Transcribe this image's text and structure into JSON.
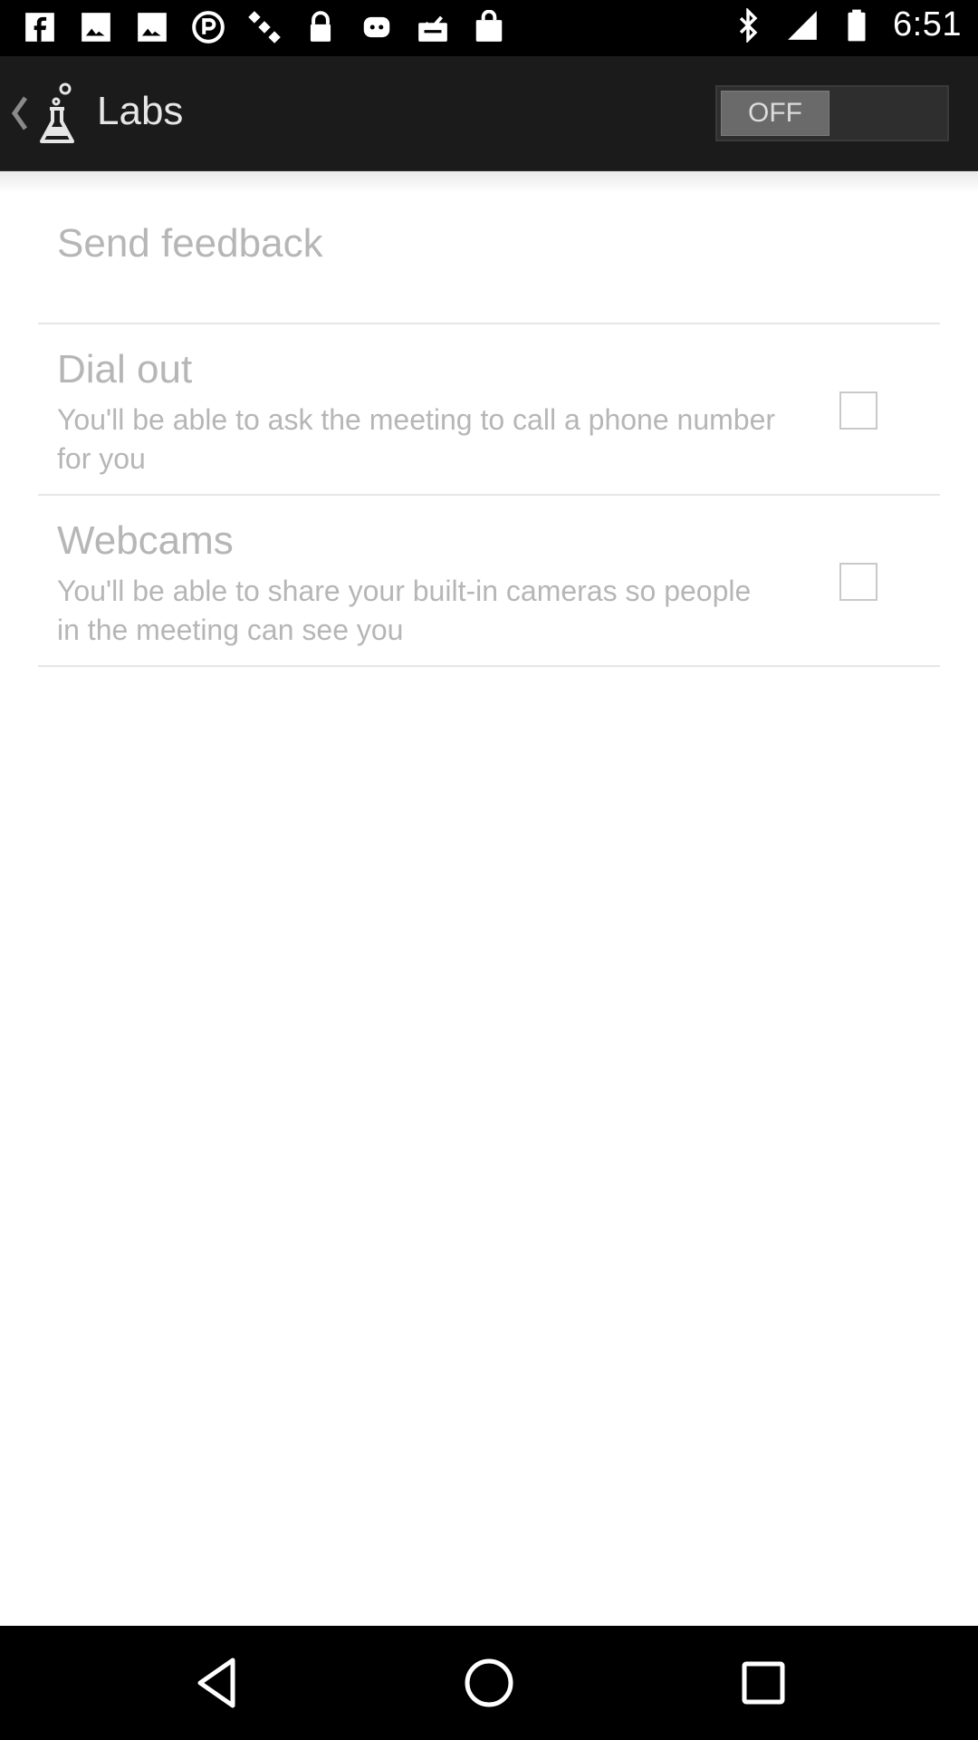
{
  "status_bar": {
    "time": "6:51",
    "left_icons": [
      "facebook-icon",
      "image-icon",
      "image-icon",
      "circle-p-icon",
      "satellite-icon",
      "lock-icon",
      "robot-icon",
      "inbox-check-icon",
      "bag-icon"
    ],
    "right_icons": [
      "bluetooth-icon",
      "signal-icon",
      "battery-icon"
    ]
  },
  "action_bar": {
    "title": "Labs",
    "toggle_label": "OFF"
  },
  "main": {
    "send_feedback": "Send feedback",
    "options": [
      {
        "title": "Dial out",
        "description": "You'll be able to ask the meeting to call a phone number for you",
        "checked": false
      },
      {
        "title": "Webcams",
        "description": "You'll be able to share your built-in cameras so people in the meeting can see you",
        "checked": false
      }
    ]
  },
  "nav_bar": {
    "buttons": [
      "back-icon",
      "home-icon",
      "recents-icon"
    ]
  },
  "colors": {
    "action_bar_bg": "#1b1b1b",
    "text_muted": "#b6b6b6",
    "divider": "#e6e6e6"
  }
}
